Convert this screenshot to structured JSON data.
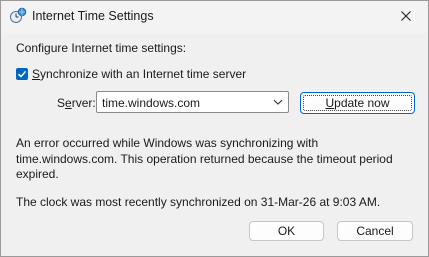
{
  "window": {
    "title": "Internet Time Settings",
    "icon": "clock-globe-icon",
    "close_icon": "close-icon"
  },
  "main": {
    "intro": "Configure Internet time settings:",
    "sync_checkbox": {
      "label_mnemonic": "S",
      "label_rest": "ynchronize with an Internet time server",
      "checked": true
    },
    "server": {
      "label_mnemonic": "e",
      "label_prefix": "S",
      "label_suffix": "rver:",
      "value": "time.windows.com"
    },
    "update_button": {
      "label_mnemonic": "U",
      "label_rest": "pdate now"
    },
    "error_message": "An error occurred while Windows was synchronizing with time.windows.com.  This operation returned because the timeout period expired.",
    "last_sync": "The clock was most recently synchronized on 31-Mar-26 at 9:03 AM."
  },
  "footer": {
    "ok_label": "OK",
    "cancel_label": "Cancel"
  },
  "colors": {
    "accent": "#0067c0",
    "background": "#f0f0f0"
  }
}
